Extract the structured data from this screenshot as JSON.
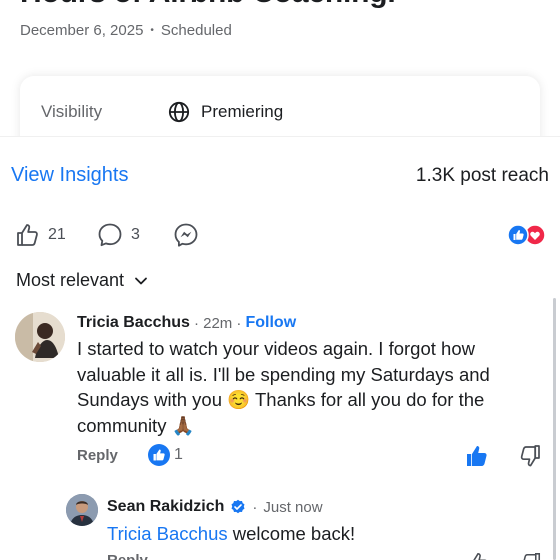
{
  "post": {
    "title": "Hours of Airbnb Coaching.",
    "date": "December 6, 2025",
    "separator": "•",
    "status": "Scheduled"
  },
  "visibility": {
    "label": "Visibility",
    "value": "Premiering",
    "icon": "globe-icon"
  },
  "insights": {
    "link_label": "View Insights",
    "reach": "1.3K post reach"
  },
  "actions": {
    "likes": "21",
    "comments": "3",
    "like_icon": "thumbs-up-icon",
    "comment_icon": "comment-bubble-icon",
    "share_icon": "messenger-icon",
    "reactions": [
      "like",
      "love"
    ]
  },
  "comments_sort": {
    "label": "Most relevant"
  },
  "comment": {
    "author": "Tricia Bacchus",
    "time": "22m",
    "follow_label": "Follow",
    "lines": [
      "I started to watch your videos again. I forgot how",
      "valuable it all is. I'll be spending my Saturdays and",
      "Sundays with you ☺️ Thanks for all you do for the",
      "community 🙏🏾"
    ],
    "reply_label": "Reply",
    "like_count": "1"
  },
  "reply": {
    "author": "Sean Rakidzich",
    "time": "Just now",
    "tagged": "Tricia Bacchus",
    "text": "welcome back!",
    "reply_label": "Reply"
  },
  "colors": {
    "accent": "#1877f2",
    "love": "#f02849",
    "muted": "#65676b"
  }
}
